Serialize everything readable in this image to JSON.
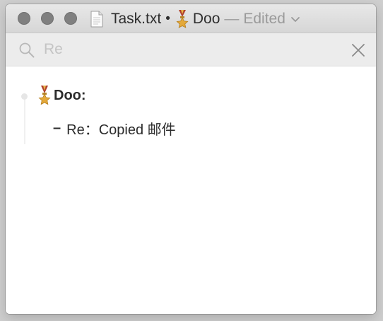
{
  "window": {
    "file_name": "Task.txt",
    "modified_indicator": "•",
    "document_title": "Doo",
    "separator": "—",
    "status": "Edited"
  },
  "search": {
    "placeholder": "Re",
    "value": ""
  },
  "outline": {
    "heading": "Doo:",
    "items": [
      {
        "dash": "–",
        "text": "Re：Copied 邮件"
      }
    ]
  },
  "icons": {
    "title": "document-icon",
    "medal": "medal-icon",
    "search": "search-icon",
    "close": "close-icon",
    "chevron": "chevron-down-icon"
  },
  "colors": {
    "traffic_light": "#808080",
    "titlebar": "#dcdcdc",
    "searchbar": "#ececec",
    "text": "#2b2b2b",
    "muted": "#9a9a9a",
    "bullet": "#e6e6e6"
  }
}
